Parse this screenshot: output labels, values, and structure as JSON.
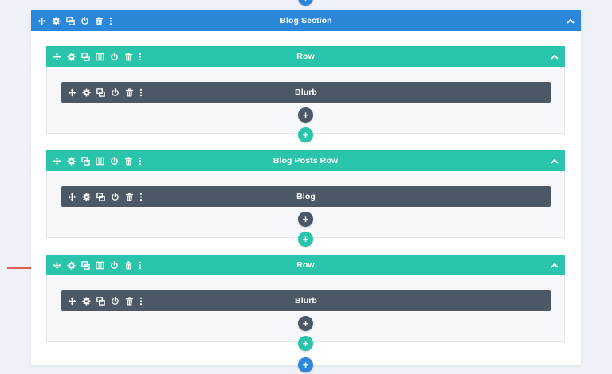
{
  "section": {
    "title": "Blog Section",
    "color": "#2b87da",
    "icons": [
      "move-icon",
      "gear-icon",
      "duplicate-icon",
      "power-icon",
      "trash-icon",
      "more-icon"
    ]
  },
  "rows": [
    {
      "title": "Row",
      "module": {
        "title": "Blurb"
      }
    },
    {
      "title": "Blog Posts Row",
      "module": {
        "title": "Blog"
      }
    },
    {
      "title": "Row",
      "module": {
        "title": "Blurb"
      }
    }
  ],
  "row_icons": [
    "move-icon",
    "gear-icon",
    "duplicate-icon",
    "columns-icon",
    "power-icon",
    "trash-icon",
    "more-icon"
  ],
  "module_icons": [
    "move-icon",
    "gear-icon",
    "duplicate-icon",
    "power-icon",
    "trash-icon",
    "more-icon"
  ],
  "add_symbol": "+",
  "colors": {
    "section": "#2b87da",
    "row": "#29c4a9",
    "module": "#4c5866",
    "arrow": "#e02b20",
    "background": "#eef1f7"
  }
}
